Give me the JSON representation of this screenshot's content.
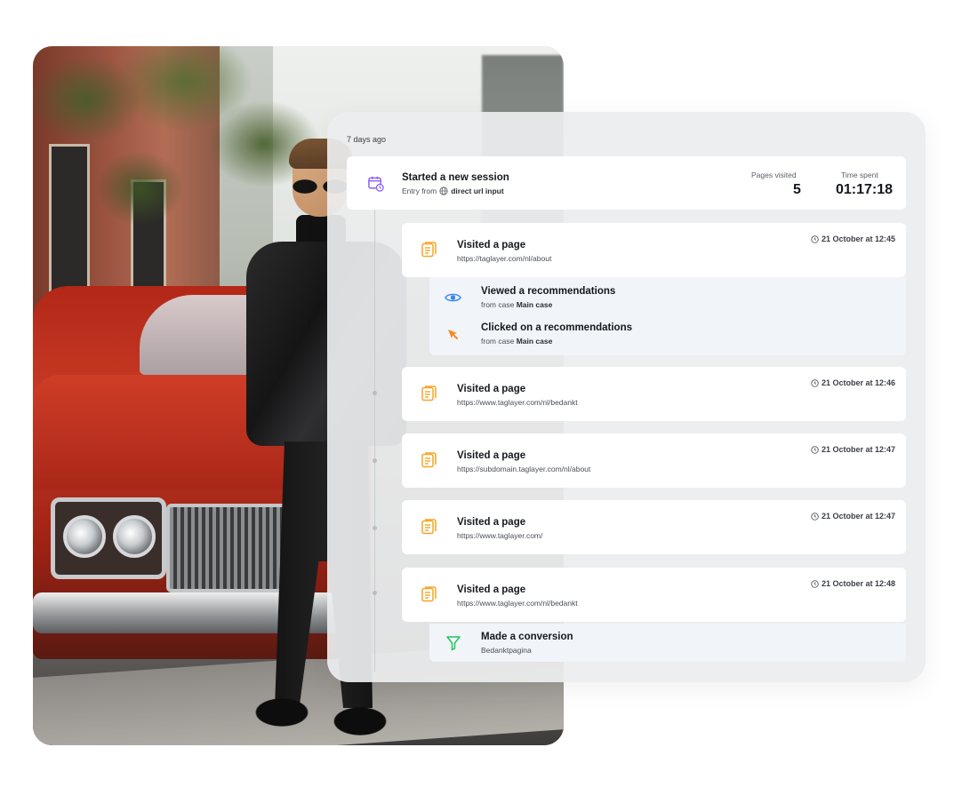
{
  "timeline": {
    "date_label": "7 days ago",
    "session": {
      "title": "Started a new session",
      "entry_prefix": "Entry from",
      "entry_source": "direct url input",
      "pages_visited_label": "Pages visited",
      "pages_visited_value": "5",
      "time_spent_label": "Time spent",
      "time_spent_value": "01:17:18",
      "icon": "calendar-clock-icon",
      "icon_color": "#8b5cf6"
    },
    "pages": [
      {
        "title": "Visited a page",
        "url": "https://taglayer.com/nl/about",
        "time": "21 October at 12:45",
        "events": [
          {
            "title": "Viewed a recommendations",
            "from_prefix": "from case",
            "case": "Main case",
            "icon": "eye-icon"
          },
          {
            "title": "Clicked on a recommendations",
            "from_prefix": "from case",
            "case": "Main case",
            "icon": "cursor-click-icon"
          }
        ]
      },
      {
        "title": "Visited a page",
        "url": "https://www.taglayer.com/nl/bedankt",
        "time": "21 October at 12:46"
      },
      {
        "title": "Visited a page",
        "url": "https://subdomain.taglayer.com/nl/about",
        "time": "21 October at 12:47"
      },
      {
        "title": "Visited a page",
        "url": "https://www.taglayer.com/",
        "time": "21 October at 12:47"
      },
      {
        "title": "Visited a page",
        "url": "https://www.taglayer.com/nl/bedankt",
        "time": "21 October at 12:48",
        "conversion": {
          "title": "Made a conversion",
          "detail": "Bedanktpagina",
          "icon": "funnel-icon"
        }
      }
    ]
  },
  "colors": {
    "page_icon": "#f5a524",
    "eye_icon": "#3b82f6",
    "cursor_icon": "#f08a24",
    "funnel_icon": "#22c55e",
    "session_icon": "#8b5cf6"
  }
}
